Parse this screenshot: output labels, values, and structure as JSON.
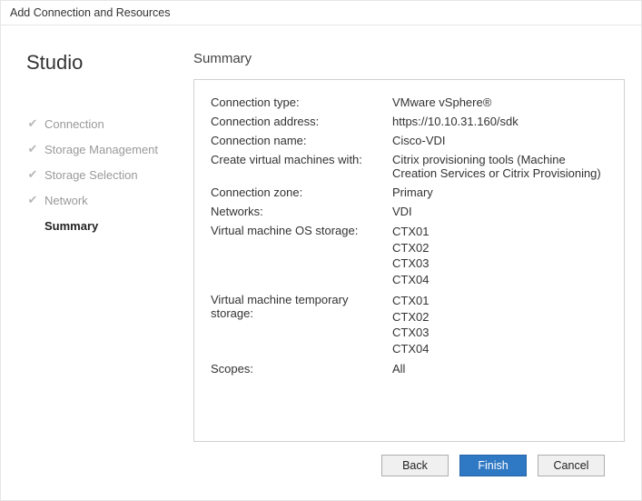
{
  "window": {
    "title": "Add Connection and Resources"
  },
  "sidebar": {
    "brand": "Studio",
    "steps": [
      {
        "label": "Connection",
        "done": true
      },
      {
        "label": "Storage Management",
        "done": true
      },
      {
        "label": "Storage Selection",
        "done": true
      },
      {
        "label": "Network",
        "done": true
      },
      {
        "label": "Summary",
        "done": false,
        "active": true
      }
    ]
  },
  "main": {
    "title": "Summary",
    "fields": {
      "connection_type": {
        "label": "Connection type:",
        "value": "VMware vSphere®"
      },
      "connection_address": {
        "label": "Connection address:",
        "value": "https://10.10.31.160/sdk"
      },
      "connection_name": {
        "label": "Connection name:",
        "value": "Cisco-VDI"
      },
      "create_vm_with": {
        "label": "Create virtual machines with:",
        "value": "Citrix provisioning tools (Machine Creation Services or Citrix Provisioning)"
      },
      "connection_zone": {
        "label": "Connection zone:",
        "value": "Primary"
      },
      "networks": {
        "label": "Networks:",
        "value": "VDI"
      },
      "os_storage": {
        "label": "Virtual machine OS storage:",
        "values": [
          "CTX01",
          "CTX02",
          "CTX03",
          "CTX04"
        ]
      },
      "temp_storage": {
        "label": "Virtual machine temporary storage:",
        "values": [
          "CTX01",
          "CTX02",
          "CTX03",
          "CTX04"
        ]
      },
      "scopes": {
        "label": "Scopes:",
        "value": "All"
      }
    }
  },
  "footer": {
    "back": "Back",
    "finish": "Finish",
    "cancel": "Cancel"
  }
}
